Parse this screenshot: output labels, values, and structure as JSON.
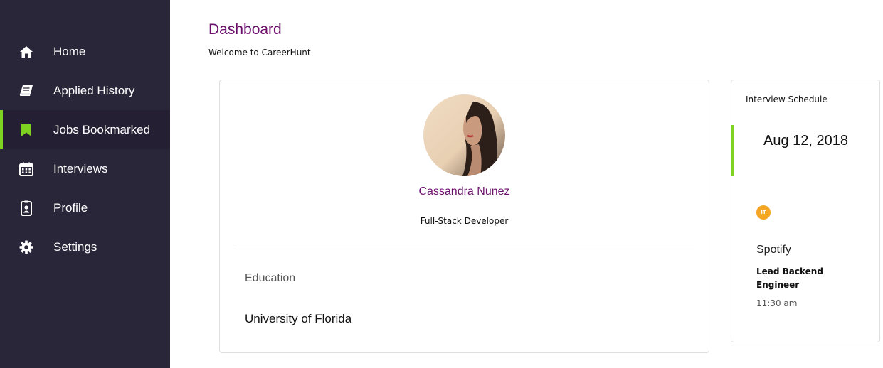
{
  "theme": {
    "accent": "#7ed321",
    "brand": "#6b0f6b",
    "badge": "#f5a623"
  },
  "sidebar": {
    "items": [
      {
        "label": "Home",
        "icon": "home-icon",
        "active": false
      },
      {
        "label": "Applied History",
        "icon": "book-icon",
        "active": false
      },
      {
        "label": "Jobs Bookmarked",
        "icon": "bookmark-icon",
        "active": true
      },
      {
        "label": "Interviews",
        "icon": "calendar-icon",
        "active": false
      },
      {
        "label": "Profile",
        "icon": "id-badge-icon",
        "active": false
      },
      {
        "label": "Settings",
        "icon": "gear-icon",
        "active": false
      }
    ]
  },
  "header": {
    "title": "Dashboard",
    "subtitle": "Welcome to CareerHunt"
  },
  "profile": {
    "name": "Cassandra Nunez",
    "role": "Full-Stack Developer",
    "education_heading": "Education",
    "school": "University of Florida"
  },
  "interview": {
    "title": "Interview Schedule",
    "date": "Aug 12, 2018",
    "badge": "IT",
    "company": "Spotify",
    "job_title": "Lead Backend Engineer",
    "time": "11:30 am"
  }
}
